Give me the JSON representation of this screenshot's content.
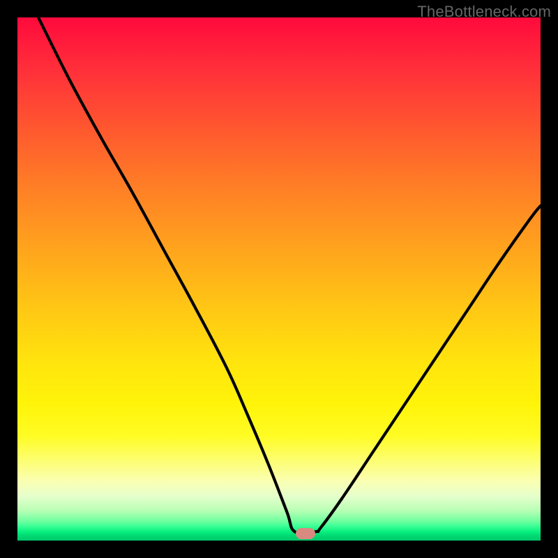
{
  "attribution": "TheBottleneck.com",
  "colors": {
    "black": "#000000",
    "curve": "#000000",
    "marker": "#d98a80",
    "attribution_text": "#666666"
  },
  "chart_data": {
    "type": "line",
    "title": "",
    "xlabel": "",
    "ylabel": "",
    "xlim": [
      0,
      100
    ],
    "ylim": [
      0,
      100
    ],
    "series": [
      {
        "name": "bottleneck-curve",
        "x": [
          4,
          10,
          16,
          22,
          28,
          34,
          40,
          44,
          48,
          51.5,
          53,
          57,
          58,
          62,
          68,
          74,
          80,
          86,
          92,
          98,
          100
        ],
        "values": [
          100,
          88,
          77,
          66.5,
          55.5,
          44.5,
          33,
          24,
          14.5,
          5.5,
          1.7,
          1.7,
          2.5,
          8,
          17,
          26,
          35,
          44,
          53,
          61.5,
          64
        ]
      }
    ],
    "marker": {
      "x": 55,
      "y": 1.4
    },
    "gradient_stops": [
      {
        "pos": 0,
        "color": "#ff0a3c"
      },
      {
        "pos": 0.1,
        "color": "#ff2f3a"
      },
      {
        "pos": 0.22,
        "color": "#ff5a2e"
      },
      {
        "pos": 0.32,
        "color": "#ff7d26"
      },
      {
        "pos": 0.44,
        "color": "#ffa31d"
      },
      {
        "pos": 0.56,
        "color": "#ffc814"
      },
      {
        "pos": 0.66,
        "color": "#ffe40d"
      },
      {
        "pos": 0.74,
        "color": "#fff40a"
      },
      {
        "pos": 0.8,
        "color": "#fffc24"
      },
      {
        "pos": 0.885,
        "color": "#fbffb0"
      },
      {
        "pos": 0.915,
        "color": "#e6ffcc"
      },
      {
        "pos": 0.942,
        "color": "#baffb6"
      },
      {
        "pos": 0.963,
        "color": "#6fffa0"
      },
      {
        "pos": 0.972,
        "color": "#3eff97"
      },
      {
        "pos": 0.983,
        "color": "#08f07e"
      },
      {
        "pos": 0.991,
        "color": "#00d873"
      },
      {
        "pos": 1.0,
        "color": "#00c86a"
      }
    ]
  }
}
